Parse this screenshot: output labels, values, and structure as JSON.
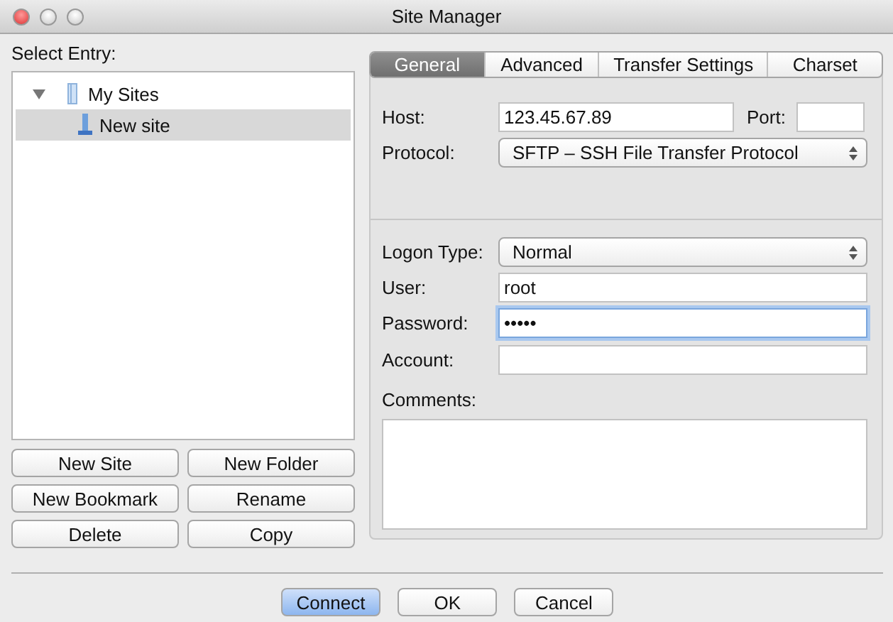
{
  "window": {
    "title": "Site Manager"
  },
  "select_entry_label": "Select Entry:",
  "tree": [
    {
      "label": "My Sites",
      "kind": "folder",
      "expanded": true,
      "selected": false,
      "children": [
        {
          "label": "New site",
          "kind": "site",
          "selected": true
        }
      ]
    }
  ],
  "entry_buttons": [
    "New Site",
    "New Folder",
    "New Bookmark",
    "Rename",
    "Delete",
    "Copy"
  ],
  "tabs": [
    {
      "label": "General",
      "selected": true
    },
    {
      "label": "Advanced",
      "selected": false
    },
    {
      "label": "Transfer Settings",
      "selected": false
    },
    {
      "label": "Charset",
      "selected": false
    }
  ],
  "general": {
    "host_label": "Host:",
    "host": "123.45.67.89",
    "port_label": "Port:",
    "protocol_label": "Protocol:",
    "protocol": "SFTP – SSH File Transfer Protocol",
    "logon_type_label": "Logon Type:",
    "logon_type": "Normal",
    "user_label": "User:",
    "user": "root",
    "password_label": "Password:",
    "password": "•••••",
    "password_focused": true,
    "account_label": "Account:",
    "comments_label": "Comments:"
  },
  "buttons": [
    {
      "label": "Connect",
      "default": true
    },
    {
      "label": "OK",
      "default": false
    },
    {
      "label": "Cancel",
      "default": false
    }
  ]
}
